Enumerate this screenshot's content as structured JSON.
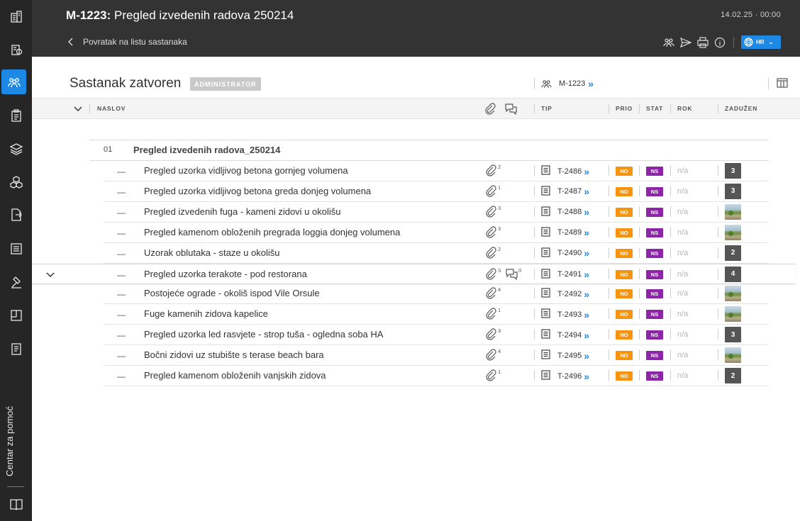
{
  "sidebar": {
    "help_label": "Centar za pomoć",
    "icons": [
      "building-icon",
      "settings-building-icon",
      "meetings-icon",
      "clipboard-icon",
      "layers-icon",
      "cubes-icon",
      "document-export-icon",
      "list-document-icon",
      "gavel-icon",
      "floorplan-icon",
      "report-icon",
      "help-book-icon"
    ]
  },
  "header": {
    "code": "M-1223:",
    "title": "Pregled izvedenih radova 250214",
    "datetime": "14.02.25 · 00:00",
    "back_label": "Povratak na listu sastanaka",
    "language": "HR"
  },
  "meeting": {
    "status_title": "Sastanak zatvoren",
    "role_badge": "ADMINISTRATOR",
    "ref": "M-1223"
  },
  "columns": {
    "naslov": "NASLOV",
    "tip": "TIP",
    "prio": "PRIO",
    "stat": "STAT",
    "rok": "ROK",
    "zaduzen": "ZADUŽEN"
  },
  "section": {
    "number": "01",
    "title": "Pregled izvedenih radova_250214"
  },
  "rows": [
    {
      "dash": "—",
      "title": "Pregled uzorka vidljivog betona gornjeg volumena",
      "attachments": "2",
      "comments": "",
      "tip": "T-2486",
      "prio": "NO",
      "stat": "NS",
      "rok": "n/a",
      "assignee": "3"
    },
    {
      "dash": "—",
      "title": "Pregled uzorka vidljivog betona greda donjeg volumena",
      "attachments": "1",
      "comments": "",
      "tip": "T-2487",
      "prio": "NO",
      "stat": "NS",
      "rok": "n/a",
      "assignee": "3"
    },
    {
      "dash": "—",
      "title": "Pregled izvedenih fuga -  kameni zidovi u okolišu",
      "attachments": "3",
      "comments": "",
      "tip": "T-2488",
      "prio": "NO",
      "stat": "NS",
      "rok": "n/a",
      "assignee": ""
    },
    {
      "dash": "—",
      "title": "Pregled kamenom obloženih pregrada loggia donjeg volumena",
      "attachments": "3",
      "comments": "",
      "tip": "T-2489",
      "prio": "NO",
      "stat": "NS",
      "rok": "n/a",
      "assignee": ""
    },
    {
      "dash": "—",
      "title": "Uzorak oblutaka - staze u okolišu",
      "attachments": "2",
      "comments": "",
      "tip": "T-2490",
      "prio": "NO",
      "stat": "NS",
      "rok": "n/a",
      "assignee": "2"
    },
    {
      "dash": "—",
      "title": "Pregled uzorka terakote - pod restorana",
      "attachments": "3",
      "comments": "0",
      "tip": "T-2491",
      "prio": "NO",
      "stat": "NS",
      "rok": "n/a",
      "assignee": "4"
    },
    {
      "dash": "—",
      "title": "Postojeće ograde - okoliš ispod Vile Orsule",
      "attachments": "4",
      "comments": "",
      "tip": "T-2492",
      "prio": "NO",
      "stat": "NS",
      "rok": "n/a",
      "assignee": ""
    },
    {
      "dash": "—",
      "title": "Fuge kamenih zidova kapelice",
      "attachments": "1",
      "comments": "",
      "tip": "T-2493",
      "prio": "NO",
      "stat": "NS",
      "rok": "n/a",
      "assignee": ""
    },
    {
      "dash": "—",
      "title": "Pregled uzorka led rasvjete - strop tuša - ogledna soba HA",
      "attachments": "3",
      "comments": "",
      "tip": "T-2494",
      "prio": "NO",
      "stat": "NS",
      "rok": "n/a",
      "assignee": "3"
    },
    {
      "dash": "—",
      "title": "Bočni zidovi uz stubište s terase beach bara",
      "attachments": "4",
      "comments": "",
      "tip": "T-2495",
      "prio": "NO",
      "stat": "NS",
      "rok": "n/a",
      "assignee": ""
    },
    {
      "dash": "—",
      "title": "Pregled kamenom obloženih vanjskih zidova",
      "attachments": "1",
      "comments": "",
      "tip": "T-2496",
      "prio": "NO",
      "stat": "NS",
      "rok": "n/a",
      "assignee": "2"
    }
  ],
  "colors": {
    "accent": "#1e88e5",
    "prio": "#f7940f",
    "stat": "#8e24aa",
    "topbar": "#333333",
    "sidebar": "#262626"
  }
}
